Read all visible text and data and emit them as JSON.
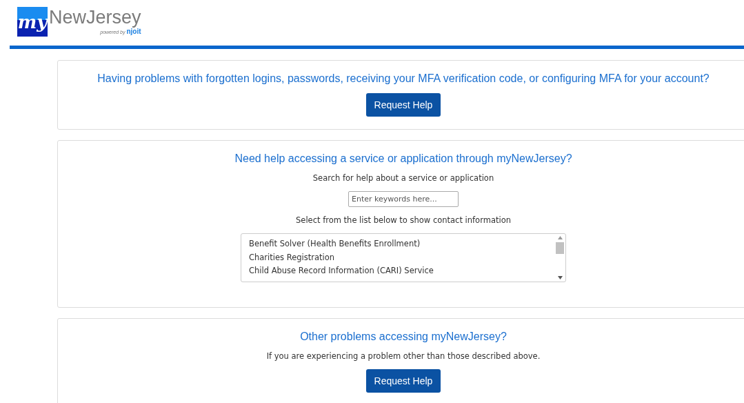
{
  "logo": {
    "badge": "my",
    "name": "NewJersey",
    "powered_by": "powered by",
    "brand": "njoit"
  },
  "sections": [
    {
      "kind": "button",
      "heading": "Having problems with forgotten logins, passwords, receiving your MFA verification code, or configuring MFA for your account?",
      "button": "Request Help"
    },
    {
      "kind": "search",
      "heading": "Need help accessing a service or application through myNewJersey?",
      "search_label": "Search for help about a service or application",
      "search": {
        "placeholder": "Enter keywords here..."
      },
      "list_label": "Select from the list below to show contact information",
      "services": [
        {
          "label": "Benefit Solver (Health Benefits Enrollment)",
          "selected": false
        },
        {
          "label": "Charities Registration",
          "selected": false
        },
        {
          "label": "Child Abuse Record Information (CARI) Service",
          "selected": false
        }
      ]
    },
    {
      "kind": "button",
      "heading": "Other problems accessing myNewJersey?",
      "note": "If you are experiencing a problem other than those described above.",
      "button": "Request Help"
    }
  ]
}
